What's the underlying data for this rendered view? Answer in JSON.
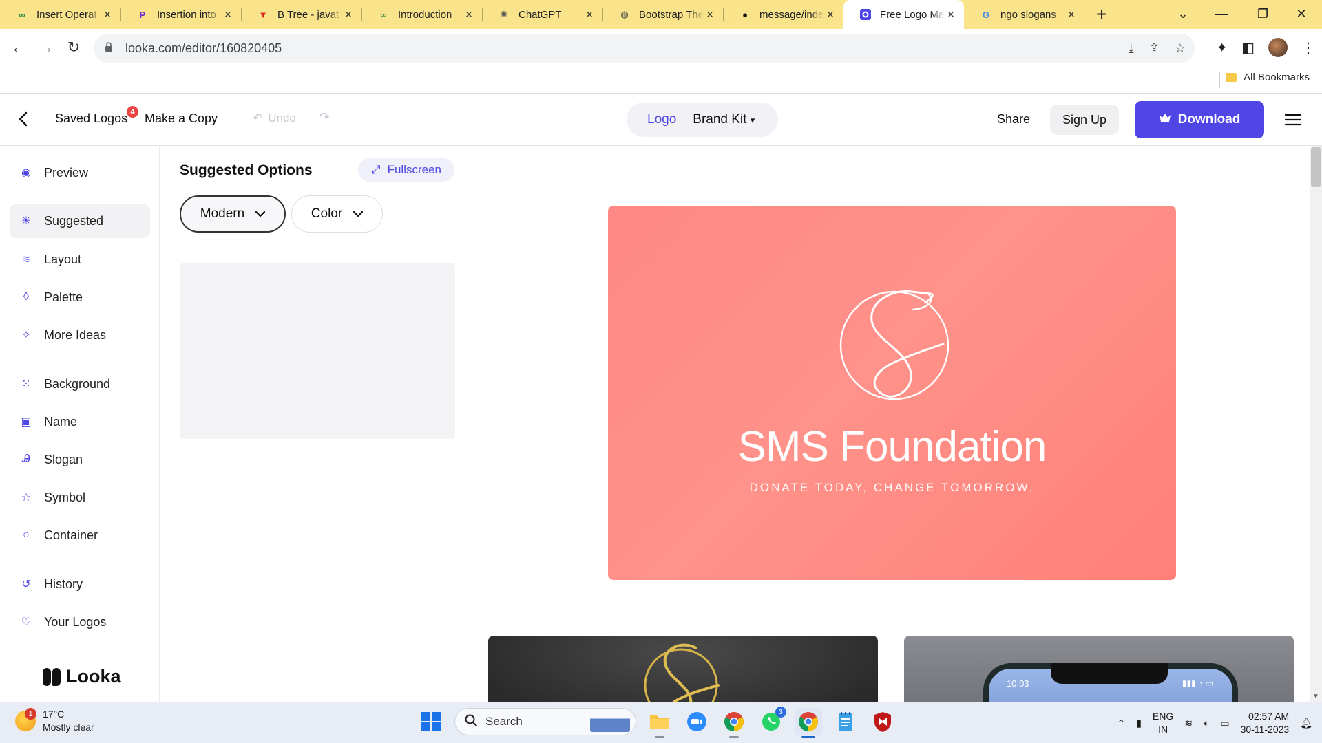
{
  "browser": {
    "tabs": [
      {
        "title": "Insert Operat",
        "icon": "gfg-icon",
        "color": "#2f8d46"
      },
      {
        "title": "Insertion into",
        "icon": "programiz-icon",
        "color": "#6b2cd1"
      },
      {
        "title": "B Tree - javat",
        "icon": "javatpoint-icon",
        "color": "#d9211f"
      },
      {
        "title": "Introduction",
        "icon": "gfg-icon",
        "color": "#2f8d46"
      },
      {
        "title": "ChatGPT",
        "icon": "chatgpt-icon",
        "color": "#555555"
      },
      {
        "title": "Bootstrap The",
        "icon": "globe-icon",
        "color": "#444444"
      },
      {
        "title": "message/inde",
        "icon": "github-icon",
        "color": "#111111"
      },
      {
        "title": "Free Logo Ma",
        "icon": "looka-icon",
        "color": "#4f46e5",
        "active": true
      },
      {
        "title": "ngo slogans",
        "icon": "google-icon",
        "color": "#4285f4"
      }
    ],
    "url": "looka.com/editor/160820405",
    "bookmarks_label": "All Bookmarks"
  },
  "header": {
    "saved_logos": "Saved Logos",
    "saved_count": "4",
    "make_copy": "Make a Copy",
    "undo": "Undo",
    "seg_logo": "Logo",
    "seg_brand_kit": "Brand Kit",
    "share": "Share",
    "sign_up": "Sign Up",
    "download": "Download"
  },
  "sidebar": {
    "items": [
      {
        "label": "Preview",
        "icon": "eye-icon"
      },
      {
        "label": "Suggested",
        "icon": "sparkle-icon",
        "active": true
      },
      {
        "label": "Layout",
        "icon": "layers-icon"
      },
      {
        "label": "Palette",
        "icon": "droplet-icon"
      },
      {
        "label": "More Ideas",
        "icon": "magic-wand-icon"
      },
      {
        "label": "Background",
        "icon": "background-grid-icon"
      },
      {
        "label": "Name",
        "icon": "text-box-icon"
      },
      {
        "label": "Slogan",
        "icon": "slogan-text-icon"
      },
      {
        "label": "Symbol",
        "icon": "star-icon"
      },
      {
        "label": "Container",
        "icon": "circle-icon"
      },
      {
        "label": "History",
        "icon": "history-icon"
      },
      {
        "label": "Your Logos",
        "icon": "heart-icon"
      }
    ],
    "brand": "Looka"
  },
  "options": {
    "title": "Suggested Options",
    "fullscreen": "Fullscreen",
    "style_dropdown": "Modern",
    "color_dropdown": "Color"
  },
  "logo": {
    "name": "SMS Foundation",
    "slogan": "DONATE TODAY, CHANGE TOMORROW.",
    "background_color": "#ff8a84"
  },
  "mockup": {
    "phone_time": "10:03"
  },
  "taskbar": {
    "temperature": "17°C",
    "weather": "Mostly clear",
    "weather_badge": "1",
    "search": "Search",
    "whatsapp_badge": "3",
    "lang_top": "ENG",
    "lang_bottom": "IN",
    "time": "02:57 AM",
    "date": "30-11-2023"
  },
  "colors": {
    "accent": "#4f46e5",
    "tabstrip": "#fae48b",
    "logo_bg": "#ff8a84"
  }
}
